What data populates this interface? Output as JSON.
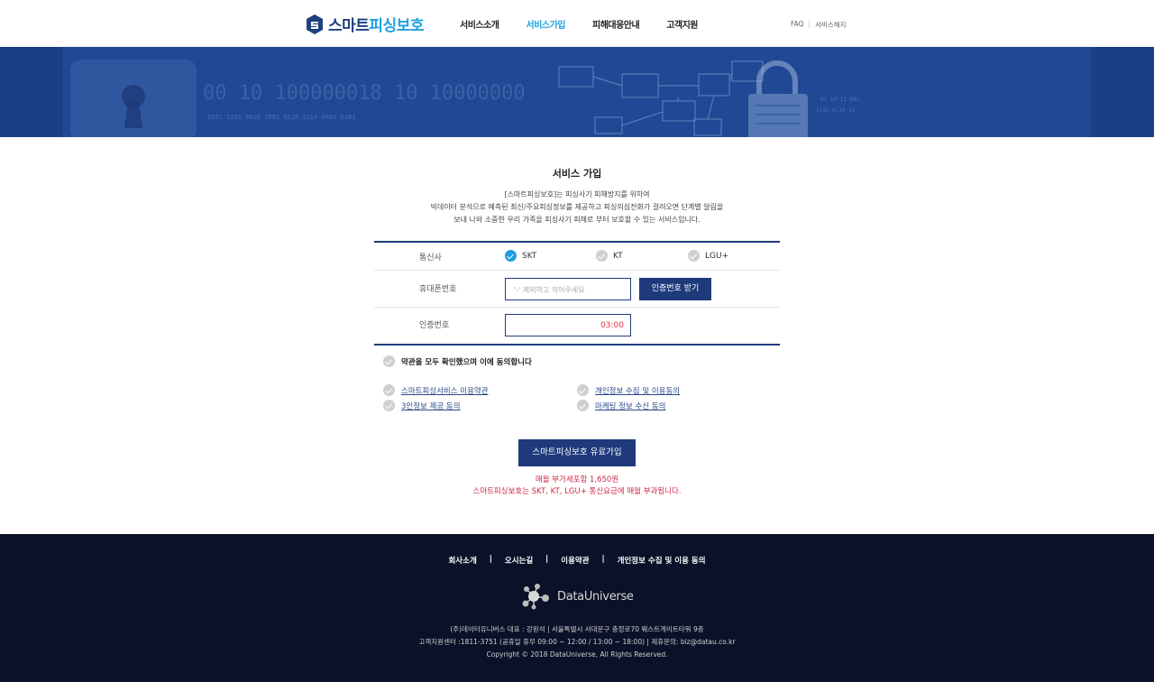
{
  "header": {
    "logo_part1": "스마트",
    "logo_part2": "피싱보호",
    "nav": [
      "서비스소개",
      "서비스가입",
      "피해대응안내",
      "고객지원"
    ],
    "util": [
      "FAQ",
      "서비스해지"
    ]
  },
  "main": {
    "title": "서비스 가입",
    "desc": [
      "[스마트피싱보호]는 피싱사기 피해방지를 위하여",
      "빅데이터 분석으로 예측된 최신/주요피싱정보를 제공하고 피싱의심전화가 걸려오면 단계별 알림을",
      "보내 나와 소중한 우리 가족을 피싱사기 피해로 부터 보호할 수 있는 서비스입니다."
    ],
    "carrier_label": "통신사",
    "carriers": [
      "SKT",
      "KT",
      "LGU+"
    ],
    "phone_label": "휴대폰번호",
    "phone_placeholder": "'-' 제외하고 적어주세요",
    "cert_button": "인증번호 받기",
    "code_label": "인증번호",
    "timer": "03:00",
    "agree_all": "약관을 모두 확인했으며 이에 동의합니다",
    "terms": [
      "스마트피싱서비스 이용약관",
      "개인정보 수집 및 이용동의",
      "3인정보 제공 동의",
      "마케팅 정보 수신 동의"
    ],
    "signup_button": "스마트피싱보호 유료가입",
    "notice": [
      "매월 부가세포함 1,650원",
      "스마트피싱보호는 SKT, KT, LGU+ 통신요금에 매월 부과됩니다."
    ]
  },
  "footer": {
    "nav": [
      "회사소개",
      "오시는길",
      "이용약관",
      "개인정보 수집 및 이용 동의"
    ],
    "logo_text": "DataUniverse",
    "info": [
      "(주)데이터유니버스 대표 : 강원석 | 서울특별시 서대문구 충정로70 웨스트게이트타워 9층",
      "고객지원센터 :1811-3751 (공휴일 휴무 09:00 ~ 12:00 / 13:00 ~ 18:00) | 제휴문의: biz@datau.co.kr",
      "Copyright © 2018 DataUniverse, All Rights Reserved."
    ]
  },
  "colors": {
    "navy": "#1e3a7b",
    "accent": "#1ea0e0",
    "alert": "#d2284a",
    "footer_bg": "#0a1128"
  },
  "state": {
    "selected_carrier": "SKT"
  }
}
